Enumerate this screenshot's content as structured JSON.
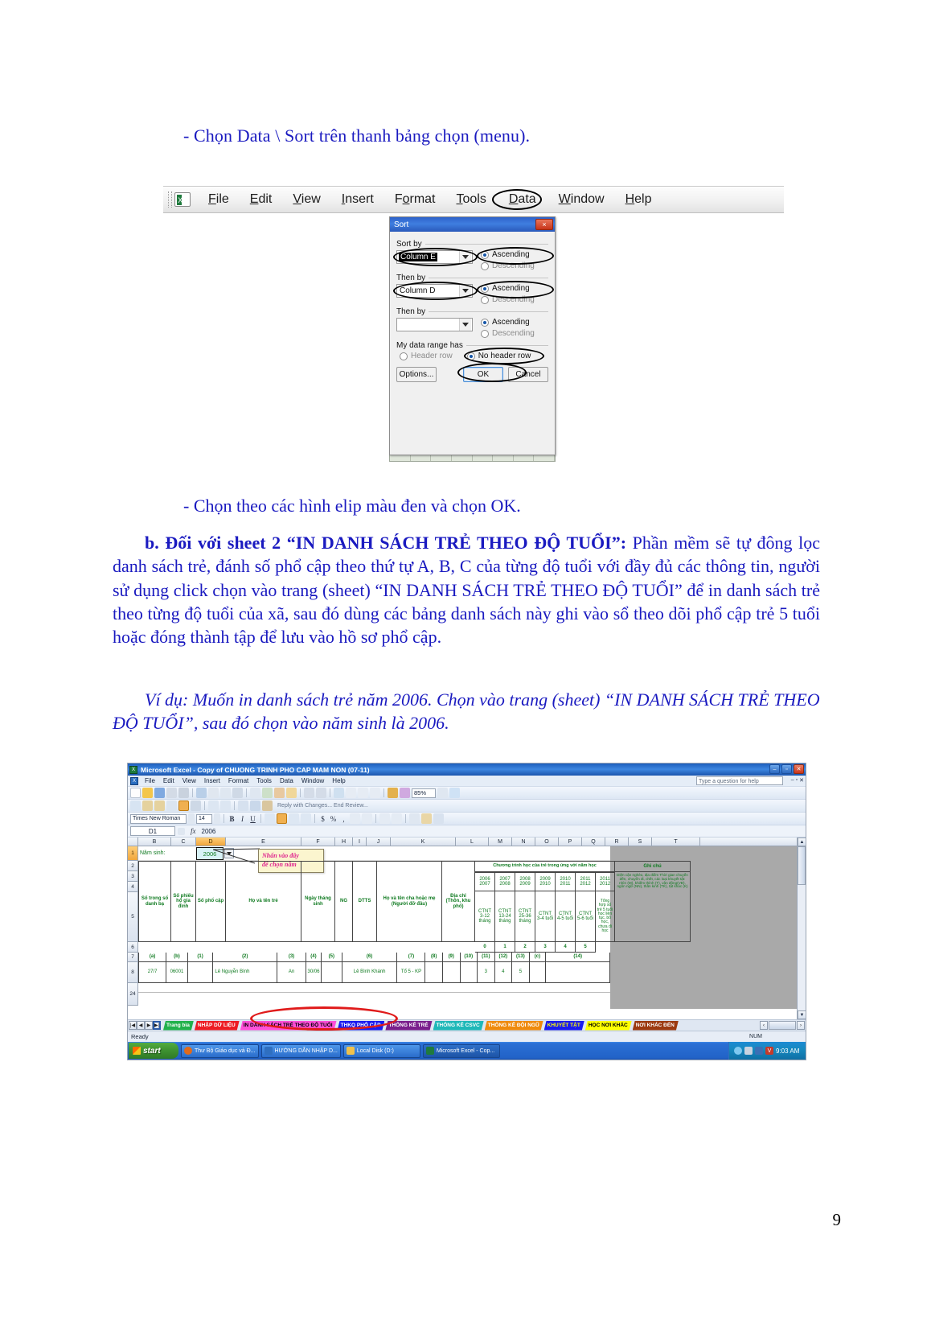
{
  "document": {
    "line_1": "- Chọn Data \\ Sort trên thanh bảng chọn (menu).",
    "line_2": "- Chọn theo các hình elip màu đen và chọn OK.",
    "para_b_bold": "b. Đối với sheet 2 “IN DANH SÁCH TRẺ THEO ĐỘ TUỔI”:",
    "para_b_rest": " Phần mềm sẽ tự đông lọc danh sách trẻ, đánh số phổ cập theo thứ tự A, B, C của từng độ tuổi với đầy đủ các thông tin, người sử dụng click chọn vào trang (sheet) “IN DANH SÁCH TRẺ THEO ĐỘ TUỔI” để in danh sách trẻ theo từng độ tuổi của xã, sau đó dùng các bảng danh sách này ghi vào sổ theo dõi phổ cập trẻ 5 tuổi hoặc đóng thành tập để lưu vào hồ sơ phổ cập.",
    "para_example": "Ví dụ: Muốn in danh sách trẻ năm 2006. Chọn vào trang (sheet) “IN DANH SÁCH TRẺ THEO ĐỘ TUỔI”, sau đó chọn vào năm sinh là 2006.",
    "page_number": "9",
    "text_color": "#1a1ac0"
  },
  "screenshot_sort": {
    "menubar": {
      "items": [
        "File",
        "Edit",
        "View",
        "Insert",
        "Format",
        "Tools",
        "Data",
        "Window",
        "Help"
      ],
      "circled_item": "Data",
      "app_icon": "excel-icon"
    },
    "dialog": {
      "title": "Sort",
      "close_label": "×",
      "group_sort_by": "Sort by",
      "group_then_by_1": "Then by",
      "group_then_by_2": "Then by",
      "group_range": "My data range has",
      "sort_by_value": "Column E",
      "then_by_1_value": "Column D",
      "then_by_2_value": "",
      "ascending_label": "Ascending",
      "descending_label": "Descending",
      "header_row_label": "Header row",
      "no_header_row_label": "No header row",
      "options_label": "Options...",
      "ok_label": "OK",
      "cancel_label": "Cancel",
      "selected_radio_sort_by": "Ascending",
      "selected_radio_then_1": "Ascending",
      "selected_radio_then_2": "Ascending",
      "selected_range_option": "No header row"
    }
  },
  "screenshot_excel": {
    "title": "Microsoft Excel - Copy of CHUONG TRINH PHO CAP MAM NON (07-11)",
    "window_buttons": [
      "–",
      "▫",
      "✕"
    ],
    "doc_buttons": [
      "–",
      "▫",
      "✕"
    ],
    "menu_items": [
      "File",
      "Edit",
      "View",
      "Insert",
      "Format",
      "Tools",
      "Data",
      "Window",
      "Help"
    ],
    "ask_question_placeholder": "Type a question for help",
    "zoom_value": "85%",
    "font_name": "Times New Roman",
    "font_size": "14",
    "review_toolbar_text": "Reply with Changes...   End Review...",
    "name_box": "D1",
    "formula_value": "2006",
    "fx_label": "fx",
    "column_headers": [
      "B",
      "C",
      "D",
      "E",
      "F",
      "H",
      "I",
      "J",
      "K",
      "L",
      "M",
      "N",
      "O",
      "P",
      "Q",
      "R",
      "S",
      "T"
    ],
    "active_column": "D",
    "row_headers": [
      "1",
      "2",
      "3",
      "4",
      "5",
      "6",
      "7",
      "8",
      "24"
    ],
    "active_row": "1",
    "cell_a1_label": "Năm sinh:",
    "cell_d1_value": "2006",
    "callout_text": "Nhấn vào đây\nđể chọn năm",
    "table_headers": [
      "Số trong sổ danh bạ",
      "Số phiếu hộ gia đình",
      "Số phổ cập",
      "Họ và tên trẻ",
      "Ngày tháng sinh",
      "NG",
      "DTTS",
      "Họ và tên cha hoặc mẹ (Người đỡ đầu)",
      "Địa chỉ (Thôn, khu phố)"
    ],
    "program_header": "Chương trình học của trẻ trong ứng với năm học",
    "notes_header": "Ghi chú",
    "year_pairs": [
      [
        "2006",
        "2007"
      ],
      [
        "2007",
        "2008"
      ],
      [
        "2008",
        "2009"
      ],
      [
        "2009",
        "2010"
      ],
      [
        "2010",
        "2011"
      ],
      [
        "2011",
        "2012"
      ],
      [
        "2011",
        "2012"
      ]
    ],
    "program_cells": [
      "CTNT 3-12 tháng",
      "CTNT 13-24 tháng",
      "CTNT 25-36 tháng",
      "CTNT 3-4 tuổi",
      "CTNT 4-5 tuổi",
      "CTNT 5-6 tuổi",
      "Tổng hợp số trẻ 5 tuổi học liên tục, bỏ học, chưa đi học"
    ],
    "notes_cell": "Diện cận nghèo, địa điểm Thời gian chuyển đến, chuyển đi, chết, các loại khuyết tật: nhìn (M), khiếm thính (T), vận động(VĐ), ngôn ngữ (NN), thần kinh (TK), tật khác (K)",
    "number_row": [
      "0",
      "1",
      "2",
      "3",
      "4",
      "5"
    ],
    "letter_row": [
      "(a)",
      "(b)",
      "(1)",
      "(2)",
      "(3)",
      "(4)",
      "(5)",
      "(6)",
      "(7)",
      "(8)",
      "(9)",
      "(10)",
      "(11)",
      "(12)",
      "(13)",
      "(c)",
      "(14)"
    ],
    "data_row": {
      "row_num": "8",
      "c1": "27/7",
      "c2": "06001",
      "c3": "Lê Nguyễn Bình",
      "c4": "An",
      "c5": "30/06",
      "c6": "Lê Bình Khánh",
      "c7": "Tổ 5 - KP",
      "c8": "3",
      "c9": "4",
      "c10": "5"
    },
    "sheet_tabs": [
      {
        "label": "Trang bìa",
        "bg": "#22b14c",
        "fg": "#ffffff"
      },
      {
        "label": "NHẬP DỮ LIỆU",
        "bg": "#ed1c24",
        "fg": "#ffffff"
      },
      {
        "label": "IN DANH SÁCH TRẺ THEO ĐỘ TUỔI",
        "bg": "#ff4fd8",
        "fg": "#000000"
      },
      {
        "label": "THKQ PHỔ CẬP",
        "bg": "#1a1af0",
        "fg": "#ffffff"
      },
      {
        "label": "THỐNG KÊ TRẺ",
        "bg": "#7a1f8c",
        "fg": "#ffffff"
      },
      {
        "label": "THỐNG KÊ CSVC",
        "bg": "#1fb8b8",
        "fg": "#ffffff"
      },
      {
        "label": "THỐNG KÊ ĐỘI NGŨ",
        "bg": "#ef8a0c",
        "fg": "#ffffff"
      },
      {
        "label": "KHUYẾT TẬT",
        "bg": "#1a1af0",
        "fg": "#ffff00"
      },
      {
        "label": "HỌC NƠI KHÁC",
        "bg": "#ffff00",
        "fg": "#000000"
      },
      {
        "label": "NƠI KHÁC ĐẾN",
        "bg": "#9c3a10",
        "fg": "#ffffff"
      }
    ],
    "selected_sheet_tab": "IN DANH SÁCH TRẺ THEO ĐỘ TUỔI",
    "status_text": "Ready",
    "status_num": "NUM",
    "taskbar": {
      "start_label": "start",
      "tasks": [
        "Thư Bộ Giáo dục và Đ...",
        "HƯỚNG DẪN NHẬP D...",
        "Local Disk (D:)",
        "Microsoft Excel - Cop..."
      ],
      "active_task": "Microsoft Excel - Cop...",
      "clock": "9:03 AM"
    }
  }
}
